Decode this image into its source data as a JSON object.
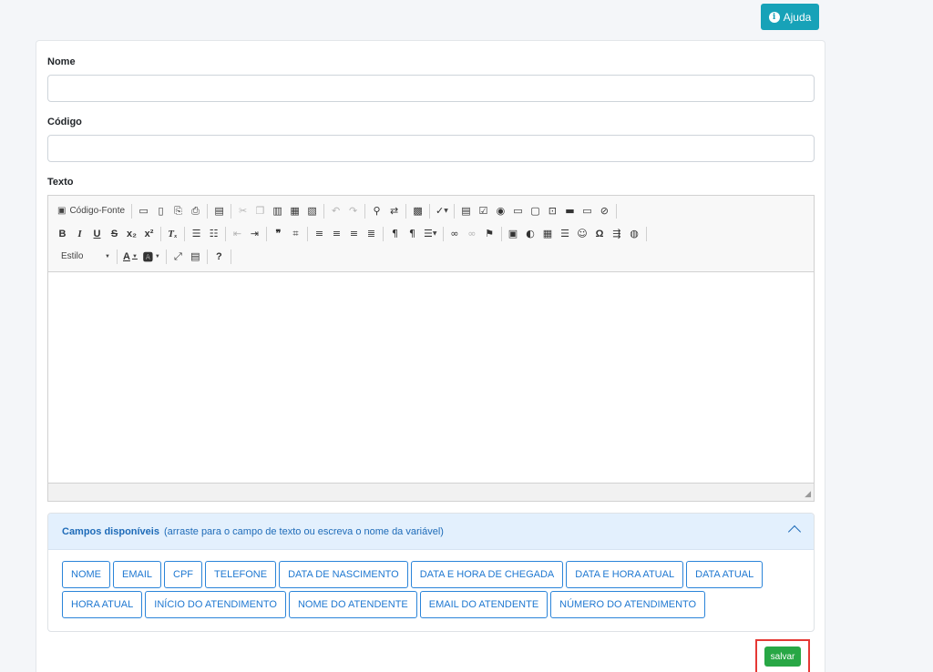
{
  "help_button": {
    "label": "Ajuda",
    "icon": "info-icon"
  },
  "form": {
    "name_label": "Nome",
    "name_value": "",
    "code_label": "Código",
    "code_value": "",
    "text_label": "Texto"
  },
  "editor": {
    "source_label": "Código-Fonte",
    "style_label": "Estilo",
    "row1_icons": [
      "save-icon",
      "new-page-icon",
      "preview-icon",
      "print-icon",
      "templates-icon",
      "cut-icon",
      "copy-icon",
      "paste-icon",
      "paste-text-icon",
      "paste-word-icon",
      "undo-icon",
      "redo-icon",
      "find-icon",
      "replace-icon",
      "select-all-icon",
      "spellcheck-icon",
      "form-icon",
      "checkbox-icon",
      "radio-icon",
      "textfield-icon",
      "textarea-icon",
      "select-icon",
      "button-icon",
      "image-button-icon",
      "hidden-field-icon"
    ],
    "row2_icons": [
      "bold-icon",
      "italic-icon",
      "underline-icon",
      "strike-icon",
      "subscript-icon",
      "superscript-icon",
      "remove-format-icon",
      "numbered-list-icon",
      "bulleted-list-icon",
      "outdent-icon",
      "indent-icon",
      "blockquote-icon",
      "div-icon",
      "align-left-icon",
      "align-center-icon",
      "align-right-icon",
      "justify-icon",
      "ltr-icon",
      "rtl-icon",
      "language-icon",
      "link-icon",
      "unlink-icon",
      "anchor-icon",
      "image-icon",
      "flash-icon",
      "table-icon",
      "horizontal-rule-icon",
      "smiley-icon",
      "special-char-icon",
      "page-break-icon",
      "iframe-icon"
    ],
    "row3_icons": [
      "text-color-icon",
      "bg-color-icon",
      "maximize-icon",
      "show-blocks-icon",
      "about-icon"
    ]
  },
  "fields_panel": {
    "title": "Campos disponíveis",
    "hint": "(arraste para o campo de texto ou escreva o nome da variável)",
    "row1": [
      "NOME",
      "EMAIL",
      "CPF",
      "TELEFONE",
      "DATA DE NASCIMENTO",
      "DATA E HORA DE CHEGADA",
      "DATA E HORA ATUAL",
      "DATA ATUAL"
    ],
    "row2": [
      "HORA ATUAL",
      "INÍCIO DO ATENDIMENTO",
      "NOME DO ATENDENTE",
      "EMAIL DO ATENDENTE",
      "NÚMERO DO ATENDIMENTO"
    ]
  },
  "save_button": {
    "label": "salvar"
  },
  "colors": {
    "help": "#17a2b8",
    "save": "#28a745",
    "chip_border": "#2a84d9",
    "panel_header": "#e3f0fd",
    "highlight": "#e53935"
  }
}
